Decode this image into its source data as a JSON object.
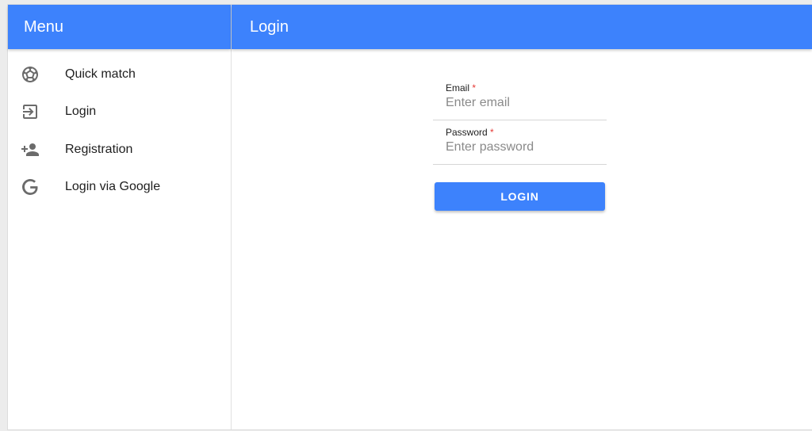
{
  "sidebar": {
    "title": "Menu",
    "items": [
      {
        "label": "Quick match",
        "icon": "soccer-ball-icon"
      },
      {
        "label": "Login",
        "icon": "login-arrow-icon"
      },
      {
        "label": "Registration",
        "icon": "person-add-icon"
      },
      {
        "label": "Login via Google",
        "icon": "google-icon"
      }
    ]
  },
  "main": {
    "title": "Login",
    "form": {
      "email": {
        "label": "Email",
        "required_mark": "*",
        "value": "",
        "placeholder": "Enter email"
      },
      "password": {
        "label": "Password",
        "required_mark": "*",
        "value": "",
        "placeholder": "Enter password"
      },
      "submit_label": "LOGIN"
    }
  },
  "colors": {
    "primary": "#3d82fc",
    "required": "#e53935",
    "icon": "#6b6b6b"
  }
}
